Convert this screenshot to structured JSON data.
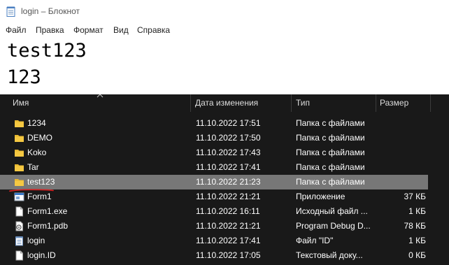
{
  "notepad": {
    "title": "login – Блокнот",
    "menu": [
      "Файл",
      "Правка",
      "Формат",
      "Вид",
      "Справка"
    ],
    "content_lines": [
      "test123",
      "123"
    ]
  },
  "explorer": {
    "columns": [
      "Имя",
      "Дата изменения",
      "Тип",
      "Размер"
    ],
    "rows": [
      {
        "icon": "folder-icon",
        "name": "1234",
        "date": "11.10.2022 17:51",
        "type": "Папка с файлами",
        "size": ""
      },
      {
        "icon": "folder-icon",
        "name": "DEMO",
        "date": "11.10.2022 17:50",
        "type": "Папка с файлами",
        "size": ""
      },
      {
        "icon": "folder-icon",
        "name": "Koko",
        "date": "11.10.2022 17:43",
        "type": "Папка с файлами",
        "size": ""
      },
      {
        "icon": "folder-icon",
        "name": "Tar",
        "date": "11.10.2022 17:41",
        "type": "Папка с файлами",
        "size": ""
      },
      {
        "icon": "folder-icon",
        "name": "test123",
        "date": "11.10.2022 21:23",
        "type": "Папка с файлами",
        "size": "",
        "selected": true
      },
      {
        "icon": "application-icon",
        "name": "Form1",
        "date": "11.10.2022 21:21",
        "type": "Приложение",
        "size": "37 КБ"
      },
      {
        "icon": "file-icon",
        "name": "Form1.exe",
        "date": "11.10.2022 16:11",
        "type": "Исходный файл ...",
        "size": "1 КБ"
      },
      {
        "icon": "pdb-file-icon",
        "name": "Form1.pdb",
        "date": "11.10.2022 21:21",
        "type": "Program Debug D...",
        "size": "78 КБ"
      },
      {
        "icon": "text-file-icon",
        "name": "login",
        "date": "11.10.2022 17:41",
        "type": "Файл \"ID\"",
        "size": "1 КБ"
      },
      {
        "icon": "file-icon",
        "name": "login.ID",
        "date": "11.10.2022 17:05",
        "type": "Текстовый доку...",
        "size": "0 КБ"
      }
    ]
  },
  "colors": {
    "explorer_bg": "#191919",
    "selected_row": "#777777",
    "folder": "#f5c842",
    "annotation": "#d42020"
  }
}
